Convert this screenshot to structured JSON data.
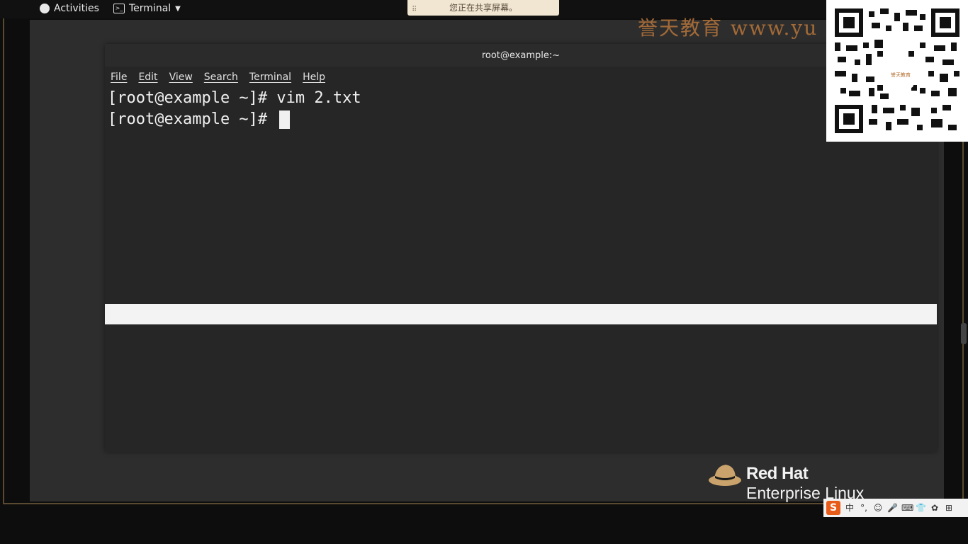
{
  "topbar": {
    "activities_label": "Activities",
    "app_menu_label": "Terminal"
  },
  "share_banner": {
    "text": "您正在共享屏幕。",
    "grip": "⠿"
  },
  "watermark": {
    "text": "誉天教育 www.yu"
  },
  "terminal": {
    "title": "root@example:~",
    "menu": [
      "File",
      "Edit",
      "View",
      "Search",
      "Terminal",
      "Help"
    ],
    "lines": [
      "[root@example ~]# vim 2.txt",
      "[root@example ~]# "
    ]
  },
  "qr": {
    "center_label": "誉天教育"
  },
  "logo": {
    "brand": "Red Hat",
    "product": "Enterprise Linux",
    "icon": "redhat-hat-icon"
  },
  "ime": {
    "logo": "S",
    "items": [
      "中",
      "°,",
      "☺",
      "🎤",
      "⌨",
      "👕",
      "✿",
      "⊞"
    ]
  },
  "colors": {
    "accent": "#e85c1a",
    "watermark": "#b8753a",
    "banner_bg": "#f0e6d1",
    "terminal_bg": "#262626"
  }
}
